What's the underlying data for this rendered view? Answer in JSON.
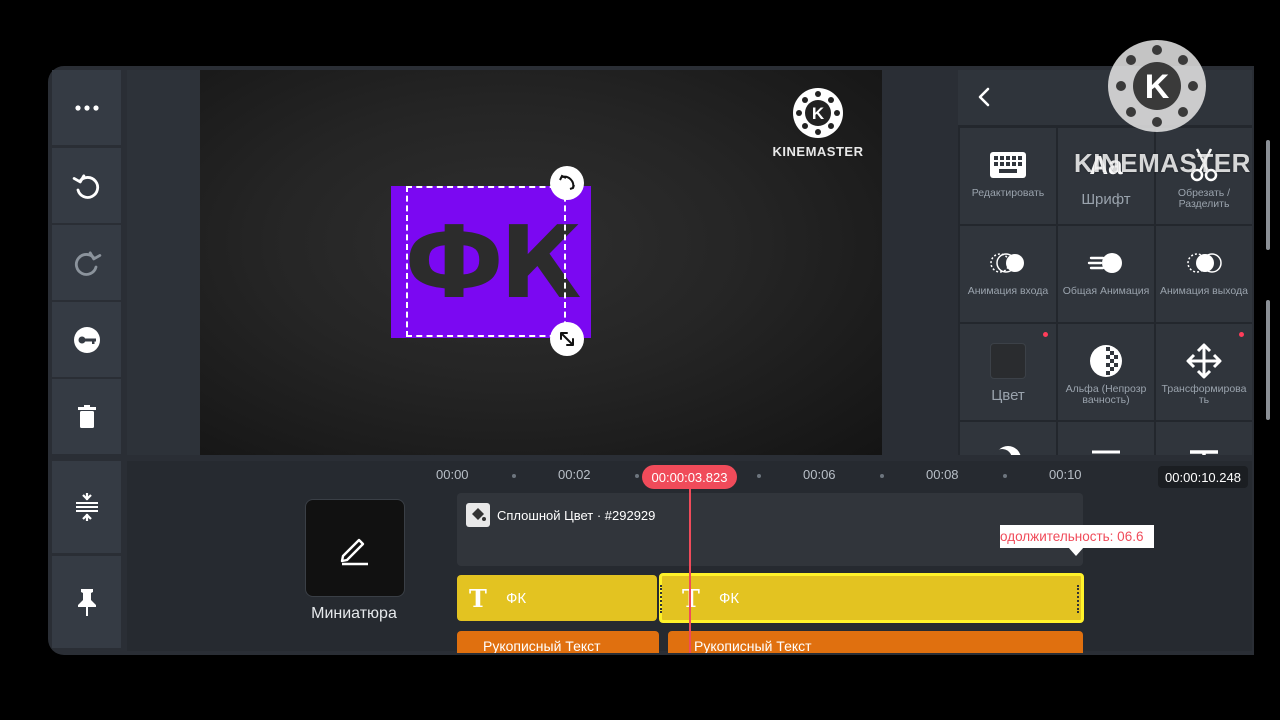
{
  "app": {
    "watermark": "KINEMASTER",
    "watermark_letter": "K"
  },
  "preview": {
    "text_layer": "ФК"
  },
  "panel": {
    "items": [
      {
        "label": "Редактировать",
        "icon": "keyboard-icon"
      },
      {
        "label": "Шрифт",
        "icon": "font-icon",
        "glyph": "Aa"
      },
      {
        "label": "Обрезать / Разделить",
        "icon": "scissors-icon"
      },
      {
        "label": "Анимация входа",
        "icon": "in-animation-icon"
      },
      {
        "label": "Общая Анимация",
        "icon": "overall-animation-icon"
      },
      {
        "label": "Анимация выхода",
        "icon": "out-animation-icon"
      },
      {
        "label": "Цвет",
        "icon": "color-swatch-icon"
      },
      {
        "label": "Альфа (Непрозр вачность)",
        "icon": "alpha-icon"
      },
      {
        "label": "Трансформирова ть",
        "icon": "transform-icon"
      }
    ]
  },
  "timeline": {
    "ruler": [
      "00:00",
      "00:02",
      "00:06",
      "00:08",
      "00:10"
    ],
    "playhead_time": "00:00:03.823",
    "total_time": "00:00:10.248",
    "thumbnail_label": "Миниатюра",
    "solid_track_label": "Сплошной Цвет · #292929",
    "duration_tooltip": "одолжительность: 06.6",
    "clip_a": "ФК",
    "clip_b": "ФК",
    "orange_a": "Рукописный Текст",
    "orange_b": "Рукописный Текст"
  },
  "colors": {
    "accent": "#f04b5a",
    "text_layer_bg": "#7b08f2",
    "clip_yellow": "#e3c321",
    "clip_orange": "#e0700f"
  }
}
